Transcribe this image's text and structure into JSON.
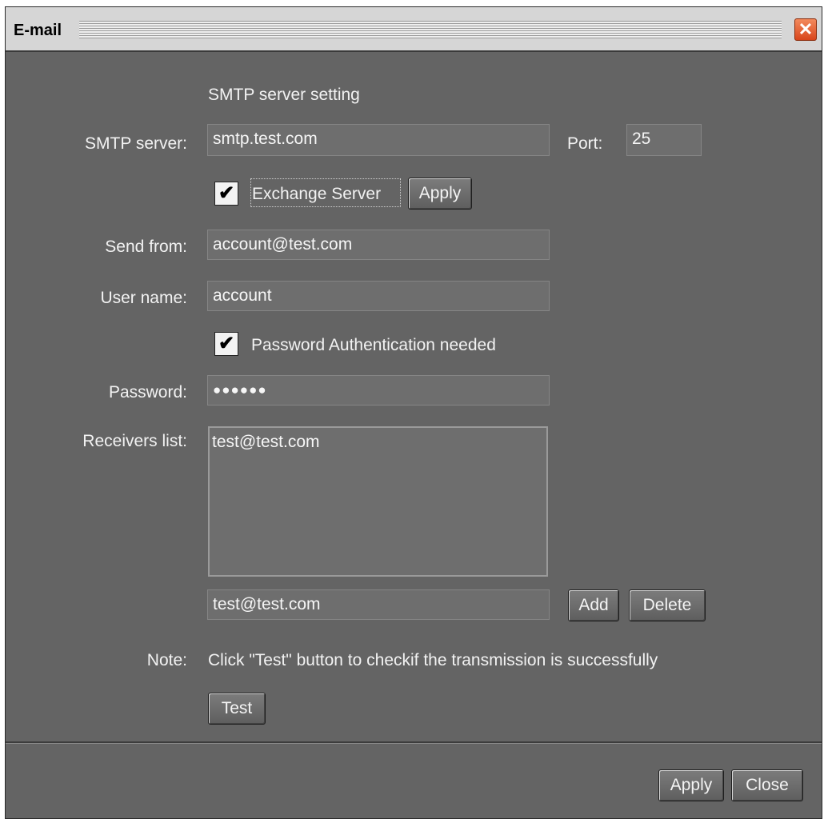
{
  "window": {
    "title": "E-mail"
  },
  "section_title": "SMTP server setting",
  "smtp": {
    "label": "SMTP server:",
    "value": "smtp.test.com",
    "port_label": "Port:",
    "port_value": "25"
  },
  "exchange": {
    "checked": true,
    "label": "Exchange Server",
    "apply_label": "Apply"
  },
  "send_from": {
    "label": "Send from:",
    "value": "account@test.com"
  },
  "user_name": {
    "label": "User name:",
    "value": "account"
  },
  "password_auth": {
    "checked": true,
    "label": "Password Authentication needed"
  },
  "password": {
    "label": "Password:",
    "value": "●●●●●●"
  },
  "receivers": {
    "label": "Receivers list:",
    "items": [
      "test@test.com"
    ],
    "input_value": "test@test.com",
    "add_label": "Add",
    "delete_label": "Delete"
  },
  "note": {
    "label": "Note:",
    "text": "Click \"Test\" button to checkif the transmission is successfully",
    "test_label": "Test"
  },
  "footer": {
    "apply_label": "Apply",
    "close_label": "Close"
  },
  "icons": {
    "close": "close-icon",
    "check": "checkmark-icon"
  }
}
